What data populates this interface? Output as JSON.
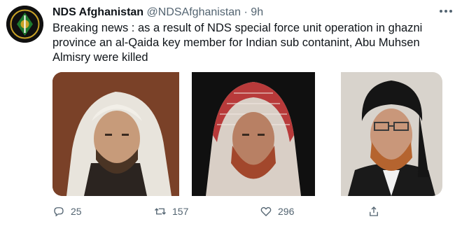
{
  "tweet": {
    "author_name": "NDS Afghanistan",
    "handle": "@NDSAfghanistan",
    "separator": "·",
    "time": "9h",
    "text": "Breaking news : as a result of NDS special force unit operation in ghazni province an al-Qaida key member for Indian sub contanint, Abu Muhsen Almisry were killed",
    "more_icon": "more-dots-icon"
  },
  "media": {
    "photos": [
      {
        "name": "photo-man-white-turban"
      },
      {
        "name": "photo-man-red-keffiyeh"
      },
      {
        "name": "photo-man-black-turban"
      }
    ]
  },
  "actions": {
    "reply_count": "25",
    "retweet_count": "157",
    "like_count": "296",
    "icons": [
      "reply-icon",
      "retweet-icon",
      "like-icon",
      "share-icon"
    ]
  },
  "colors": {
    "text": "#0f1419",
    "secondary": "#536471",
    "avatar_bg": "#101010",
    "avatar_green": "#1f7a2e"
  }
}
